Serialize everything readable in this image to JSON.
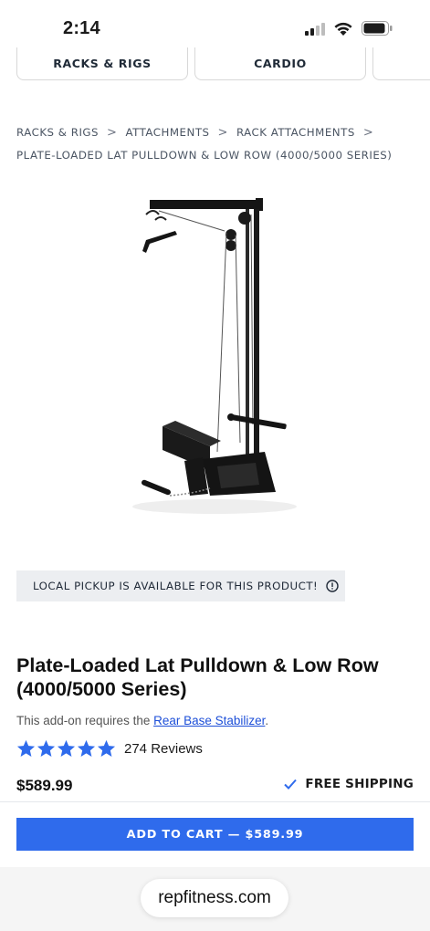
{
  "status_bar": {
    "time": "2:14"
  },
  "category_tabs": [
    {
      "label": "RACKS & RIGS"
    },
    {
      "label": "CARDIO"
    },
    {
      "label": ""
    }
  ],
  "breadcrumb": [
    {
      "label": "RACKS & RIGS"
    },
    {
      "label": "ATTACHMENTS"
    },
    {
      "label": "RACK ATTACHMENTS"
    },
    {
      "label": "PLATE-LOADED LAT PULLDOWN & LOW ROW (4000/5000 SERIES)"
    }
  ],
  "breadcrumb_separator": ">",
  "pickup_banner": {
    "text": "LOCAL PICKUP IS AVAILABLE FOR THIS PRODUCT!",
    "icon": "info-icon"
  },
  "product": {
    "title": "Plate-Loaded Lat Pulldown & Low Row (4000/5000 Series)",
    "addon_prefix": "This add-on requires the ",
    "addon_link": "Rear Base Stabilizer",
    "addon_suffix": ".",
    "rating": 5,
    "rating_max": 5,
    "reviews": "274 Reviews",
    "price": "$589.99",
    "shipping": "FREE SHIPPING"
  },
  "add_to_cart": {
    "label": "ADD TO CART — $589.99"
  },
  "browser": {
    "url": "repfitness.com"
  },
  "colors": {
    "accent": "#2f6bec",
    "star": "#2f6bec",
    "link": "#1d4fd8",
    "banner_bg": "#eceef1"
  }
}
